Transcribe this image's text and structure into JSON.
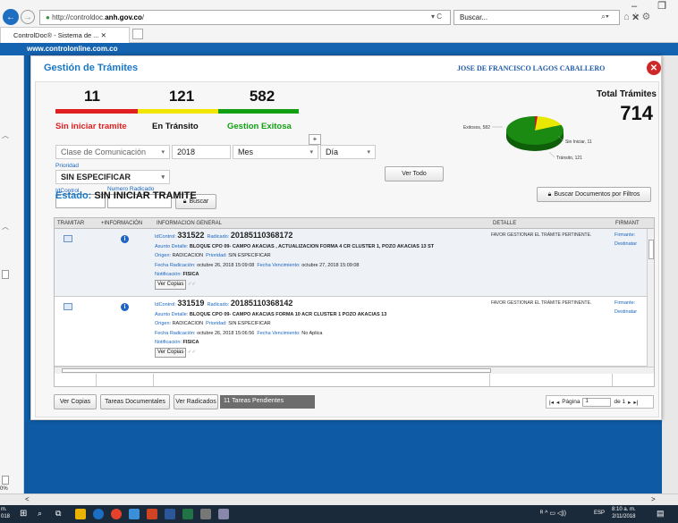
{
  "browser": {
    "url_prefix": "http://controldoc.",
    "url_domain": "anh.gov.co",
    "url_suffix": "/",
    "address_controls": "▾ C",
    "search_placeholder": "Buscar...",
    "tab_title": "ControlDoc® - Sistema de ...",
    "window_controls": "– ❐ ✕"
  },
  "site": {
    "header": "www.controlonline.com.co"
  },
  "modal": {
    "title": "Gestión de Trámites",
    "user": "JOSE DE FRANCISCO LAGOS CABALLERO",
    "close": "✕"
  },
  "counts": [
    {
      "value": "11",
      "label": "Sin iniciar tramite",
      "color": "#e02020"
    },
    {
      "value": "121",
      "label": "En Tránsito",
      "color": "#f2e600"
    },
    {
      "value": "582",
      "label": "Gestion Exitosa",
      "color": "#12a012"
    }
  ],
  "plus_button": "+",
  "total": {
    "label": "Total Trámites",
    "value": "714"
  },
  "chart_data": {
    "type": "pie",
    "slices": [
      {
        "label": "Exitosos, 582",
        "value": 582,
        "color": "#1a8a12"
      },
      {
        "label": "Sin Iniciar, 11",
        "value": 11,
        "color": "#c8161d"
      },
      {
        "label": "Tránsito, 121",
        "value": 121,
        "color": "#e8e800"
      }
    ]
  },
  "filters": {
    "clase": "Clase de Comunicación",
    "year": "2018",
    "mes": "Mes",
    "dia": "Día",
    "prioridad_label": "Prioridad",
    "prioridad": "SIN ESPECIFICAR",
    "idcontrol_label": "IdControl",
    "radicado_label": "Numero Radicado",
    "buscar": "Buscar",
    "ver_todo": "Ver Todo",
    "buscar_filtros": "Buscar Documentos por Filtros"
  },
  "estado": {
    "label": "Estado:",
    "value": "SIN INICIAR TRAMITE"
  },
  "table": {
    "headers": [
      "TRAMITAR",
      "+INFORMACIÓN",
      "INFORMACION GENERAL",
      "DETALLE",
      "FIRMANT"
    ],
    "rows": [
      {
        "idcontrol_k": "IdControl:",
        "idcontrol": "331522",
        "radicado_k": "Radicado:",
        "radicado": "20185110368172",
        "asunto_k": "Asunto Detalle:",
        "asunto": "BLOQUE CPO 09- CAMPO AKACIAS , ACTUALIZACION FORMA 4 CR CLUSTER 1, POZO AKACIAS 13 ST",
        "origen_k": "Origen:",
        "origen": "RADICACION",
        "prioridad_k": "Prioridad:",
        "prioridad": "SIN ESPECIFICAR",
        "fecha_k": "Fecha Radicación:",
        "fecha": "octubre 26, 2018 15:09:08",
        "venc_k": "Fecha Vencimiento:",
        "venc": "octubre 27, 2018 15:09:08",
        "notif_k": "Notificación:",
        "notif": "FISICA",
        "ver_copias": "Ver Copias",
        "detalle": "FAVOR GESTIONAR EL TRÁMITE PERTINENTE.",
        "firmante1": "Firmante:",
        "firmante2": "Destinatar"
      },
      {
        "idcontrol_k": "IdControl:",
        "idcontrol": "331519",
        "radicado_k": "Radicado:",
        "radicado": "20185110368142",
        "asunto_k": "Asunto Detalle:",
        "asunto": "BLOQUE CPO 09- CAMPO AKACIAS FORMA 10 ACR CLUSTER 1 POZO AKACIAS 13",
        "origen_k": "Origen:",
        "origen": "RADICACION",
        "prioridad_k": "Prioridad:",
        "prioridad": "SIN ESPECIFICAR",
        "fecha_k": "Fecha Radicación:",
        "fecha": "octubre 26, 2018 15:06:56",
        "venc_k": "Fecha Vencimiento:",
        "venc": "No Aplica",
        "notif_k": "Notificación:",
        "notif": "FISICA",
        "ver_copias": "Ver Copias",
        "detalle": "FAVOR GESTIONAR EL TRÁMITE PERTINENTE.",
        "firmante1": "Firmante:",
        "firmante2": "Destinatar"
      }
    ]
  },
  "bottom": {
    "ver_copias": "Ver Copias",
    "tareas_doc": "Tareas Documentales",
    "ver_radicados": "Ver Radicados",
    "pendientes": "11 Tareas Pendientes",
    "pagina": "Página",
    "page": "1",
    "de": "de 1"
  },
  "taskbar": {
    "time": "8:10 a. m.",
    "date": "2/11/2018",
    "lang": "ESP",
    "left_top": "m.",
    "left_bottom": "018"
  },
  "left_pct": "0%"
}
